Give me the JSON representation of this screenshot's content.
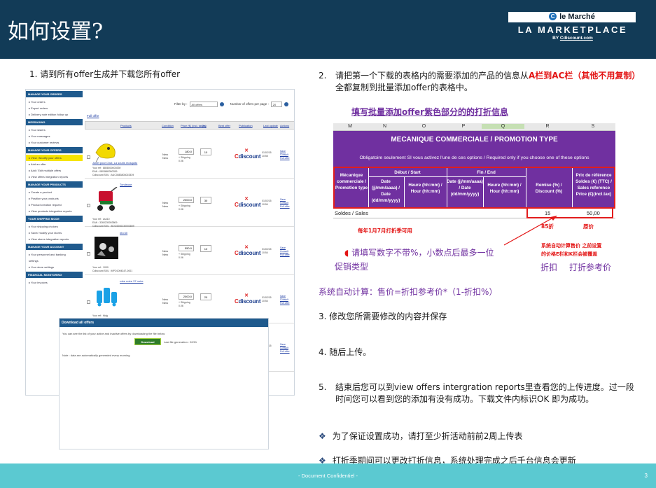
{
  "slide": {
    "title": "如何设置?",
    "footer": "- Document Confidentiel -",
    "page_number": "3"
  },
  "logo": {
    "brand_top": "le Marché",
    "brand_mid": "LA MARKETPLACE",
    "brand_by": "BY",
    "brand_site": "Cdiscount.com",
    "colors": {
      "accent": "#1d6fb8",
      "header": "#123b57",
      "footer": "#5bc9d1"
    }
  },
  "steps": {
    "s1": "1. 请到所有offer生成并下载您所有offer",
    "s2_num": "2.",
    "s2_a": "请把第一个下载的表格内的需要添加的产品的信息从",
    "s2_red": "A栏到AC栏（其他不用复制）",
    "s2_b": "全都复制到批量添加offer的表格中。",
    "fill_title": "填写批量添加offer紫色部分的的打折信息",
    "s3": "3.   修改您所需要修改的内容并保存",
    "s4": "4.   随后上传。",
    "s5_num": "5.",
    "s5": "结束后您可以到view offers intergration reports里查看您的上传进度。过一段时间您可以看到您的添加有没有成功。下载文件内标识OK 即为成功。",
    "b1": "为了保证设置成功，请打至少折活动前前2周上传表",
    "b2": "打折季期间可以更改打折信息，系统处理完成之后千台信息会更新"
  },
  "annotations": {
    "sales_date": "每年1月7月打折季可用",
    "discount_85": "85折",
    "original_price": "原价",
    "auto_calc_1": "系统自动计算售价 之前设置",
    "auto_calc_2": "的价格E栏和K栏会被覆盖",
    "hint": "请填写数字不带%，小数点后最多一位",
    "promo_type": "促销类型",
    "discount_label": "折扣",
    "ref_price": "打折参考价",
    "formula": "系统自动计算：售价=折扣参考价*（1-折扣%）"
  },
  "excel": {
    "columns": [
      "M",
      "N",
      "O",
      "P",
      "Q",
      "R",
      "S"
    ],
    "selected_column": "Q",
    "title": "MECANIQUE COMMERCIALE / PROMOTION TYPE",
    "obligatoire": "Obligatoire seulement SI vous activez l'une de ces options / Required only if you choose one of these options",
    "h_mecanique": "Mécanique commerciale / Promotion type",
    "h_debut": "Début / Start",
    "h_fin": "Fin / End",
    "h_date": "Date (jj/mm/aaaa) / Date (dd/mm/yyyy)",
    "h_heure": "Heure (hh:mm) / Hour (hh:mm)",
    "h_remise": "Remise (%) / Discount (%)",
    "h_prix": "Prix de référence Soldes (€) (TTC) / Sales reference Price (€)(incl.tax)",
    "row_type": "Soldes / Sales",
    "row_discount": "15",
    "row_price": "50,00"
  },
  "shot1": {
    "sidebar": [
      {
        "kind": "hd",
        "label": "MANAGE YOUR ORDERS"
      },
      {
        "kind": "it",
        "label": "▸ Your orders"
      },
      {
        "kind": "it",
        "label": "▸ Export orders"
      },
      {
        "kind": "it",
        "label": "▸ Delivery note edition follow up"
      },
      {
        "kind": "hd",
        "label": "MESSAGING"
      },
      {
        "kind": "it",
        "label": "▸ Your sisters"
      },
      {
        "kind": "it",
        "label": "▸ Your messages"
      },
      {
        "kind": "it",
        "label": "▸ Your customer reviews"
      },
      {
        "kind": "hd",
        "label": "MANAGE YOUR OFFERS"
      },
      {
        "kind": "hl",
        "label": "▸ View / Modify your offers"
      },
      {
        "kind": "it",
        "label": "▸ Add an offer"
      },
      {
        "kind": "it",
        "label": "▸ Add / Edit multiple offers"
      },
      {
        "kind": "it",
        "label": "▸ View offers integration reports"
      },
      {
        "kind": "hd",
        "label": "MANAGE YOUR PRODUCTS"
      },
      {
        "kind": "it",
        "label": "▸ Create a product"
      },
      {
        "kind": "it",
        "label": "▸ Position your products"
      },
      {
        "kind": "it",
        "label": "▸ Product creation request"
      },
      {
        "kind": "it",
        "label": "▸ View products integration reports"
      },
      {
        "kind": "hd",
        "label": "YOUR SHIPPING MODE"
      },
      {
        "kind": "it",
        "label": "▸ Your shipping choices"
      },
      {
        "kind": "it",
        "label": "▸ Save/ modify your stores"
      },
      {
        "kind": "it",
        "label": "▸ View stores integration reports"
      },
      {
        "kind": "hd",
        "label": "MANAGE YOUR ACCOUNT"
      },
      {
        "kind": "it",
        "label": "▸ Your personnel and banking"
      },
      {
        "kind": "it",
        "label": "settings"
      },
      {
        "kind": "it",
        "label": "▸ Your store settings"
      },
      {
        "kind": "hd",
        "label": "FINANCIAL MONITORING"
      },
      {
        "kind": "it",
        "label": "▸ Your invoices"
      }
    ],
    "filter_label": "Filter by :",
    "filter_value": "All offers",
    "per_page_label": "Number of offers per page :",
    "per_page_value": "20",
    "full_offer": "Full offre",
    "headers": [
      "Products",
      "Condition",
      "Price (€) (incl. taxes)",
      "Qty",
      "Best offer",
      "Publication",
      "Last update",
      "Actions"
    ],
    "rows": [
      {
        "name": "Jouet pour Chat, La souris mosquito",
        "meta": "Your ref : 8808000000339\nEAN : 0803680300339\nCdiscount SKU : AUC0883803003339",
        "cond": "New\nNew",
        "price": "180.0",
        "ship": "+ Shipping\n0.06",
        "qty": "10",
        "date": "01/02/15\n10:55",
        "act": "Save\nConsult\nFull offre"
      },
      {
        "name": "Tondeuse",
        "meta": "Your ref : as410\nEAN : 3260230003809\nCdiscount SKU : BOO3260230003809",
        "cond": "New\nNew",
        "price": "2000.0",
        "ship": "+ Shipping\n0.06",
        "qty": "30",
        "date": "01/02/15\n10:54",
        "act": "Save\nConsult\nFull offre"
      },
      {
        "name": "nfu 60",
        "meta": "Your ref : 1009\nCdiscount SKU : MPO1094347-0001",
        "cond": "New\nNew",
        "price": "550.0",
        "ship": "+ Shipping\n0.06",
        "qty": "10",
        "date": "01/02/15\n10:54",
        "act": "Save\nConsult\nFull offre"
      },
      {
        "name": "robe noire 37 noire",
        "meta": "Your ref : fddg\nCdiscount SKU : MPO1099534-0001",
        "cond": "New\nNew",
        "price": "2000.0",
        "ship": "+ Shipping\n0.06",
        "qty": "20",
        "date": "01/02/15\n10:54",
        "act": "Save\nConsult\nFull offre"
      },
      {
        "name": "PSOP",
        "meta": "Your ref : 001\nCdiscount SKU : AUC0009997589441",
        "cond": "New\nNew",
        "price": "10.0",
        "ship": "+ Shipping\n0.06",
        "qty": "10",
        "date": "01/02/15\n10:54",
        "act": "Save\nConsult\nFull offre"
      }
    ],
    "download_title": "Download all offers",
    "download_text": "You can see the list of your active and inactive offers by downloading the file below",
    "download_btn": "Download",
    "download_gen": "Last file generation : 02/01",
    "download_note": "Note : data are automatically generated every morning"
  }
}
